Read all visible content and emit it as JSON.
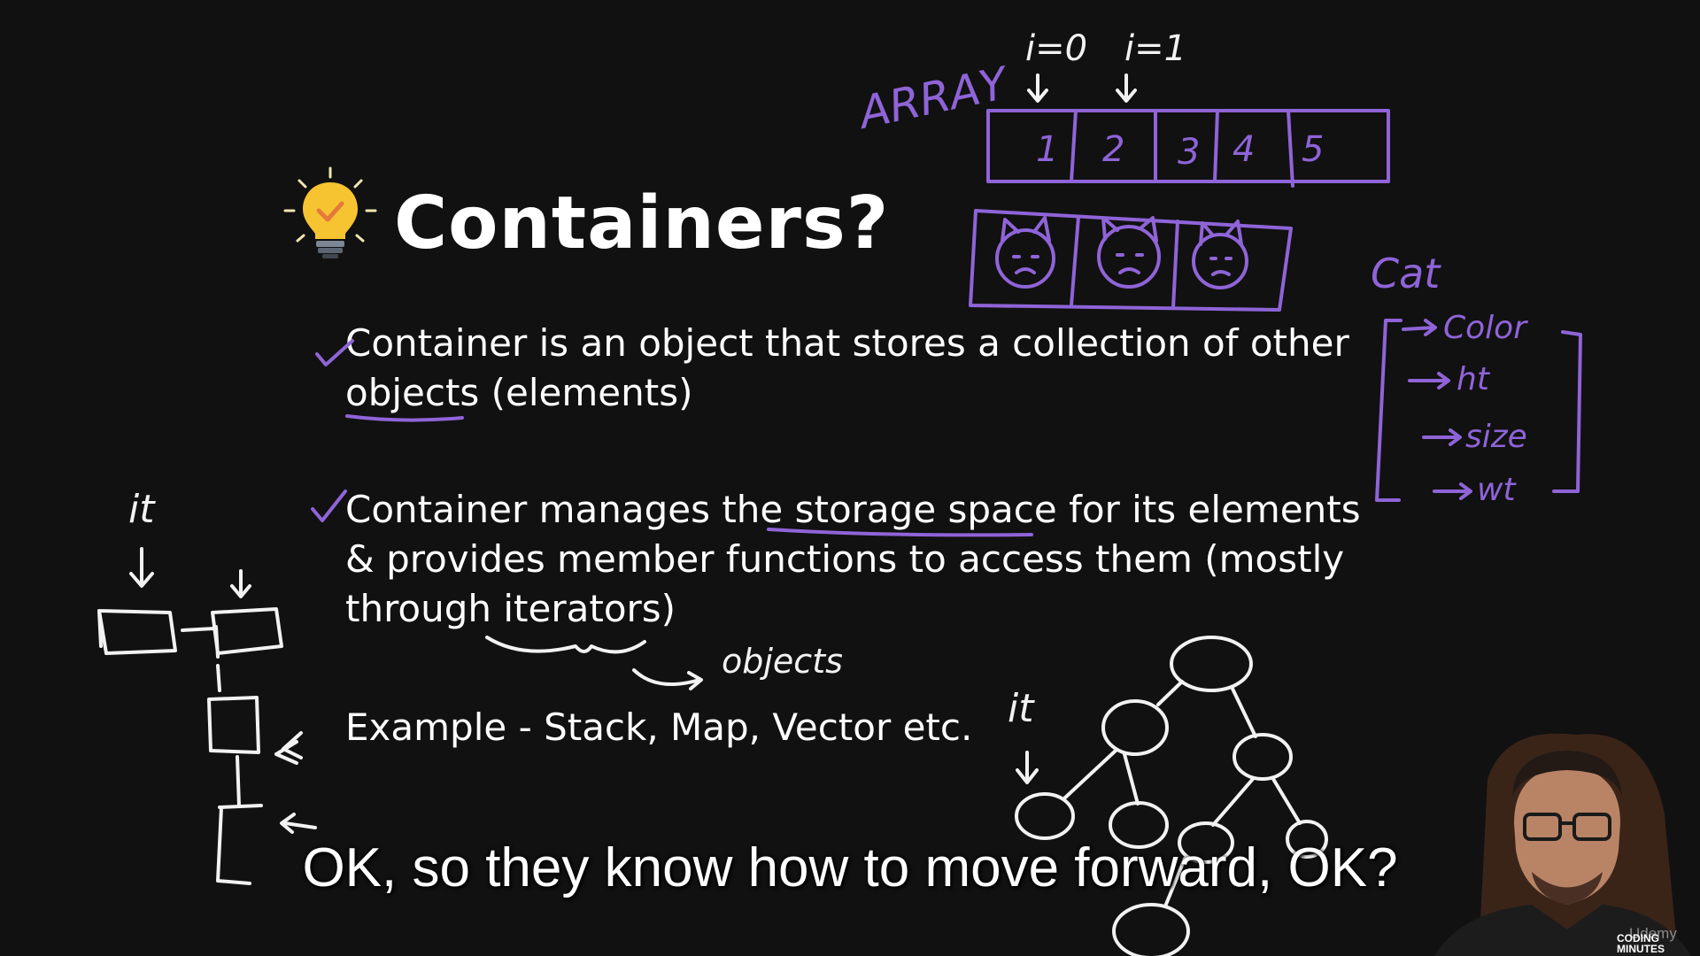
{
  "slide": {
    "title": "Containers?",
    "bullets": [
      "Container is an object that stores a collection of other objects (elements)",
      "Container manages the storage space for its elements & provides member functions to access them (mostly through iterators)",
      "Example - Stack, Map, Vector etc."
    ]
  },
  "annotations": {
    "array_label": "ARRAY",
    "index_0": "i=0",
    "index_1": "i=1",
    "array_values": [
      "1",
      "2",
      "3",
      "4",
      "5"
    ],
    "cat_label": "Cat",
    "cat_attributes": [
      "Color",
      "ht",
      "size",
      "wt"
    ],
    "iterator_label_left": "it",
    "iterator_label_tree": "it",
    "objects_note": "objects"
  },
  "caption": "OK, so they know how to move forward, OK?",
  "watermark": "Udemy",
  "brand": "CODING MINUTES",
  "colors": {
    "ink_purple": "#8f64d8",
    "background": "#111111",
    "bulb": "#f6c431"
  }
}
